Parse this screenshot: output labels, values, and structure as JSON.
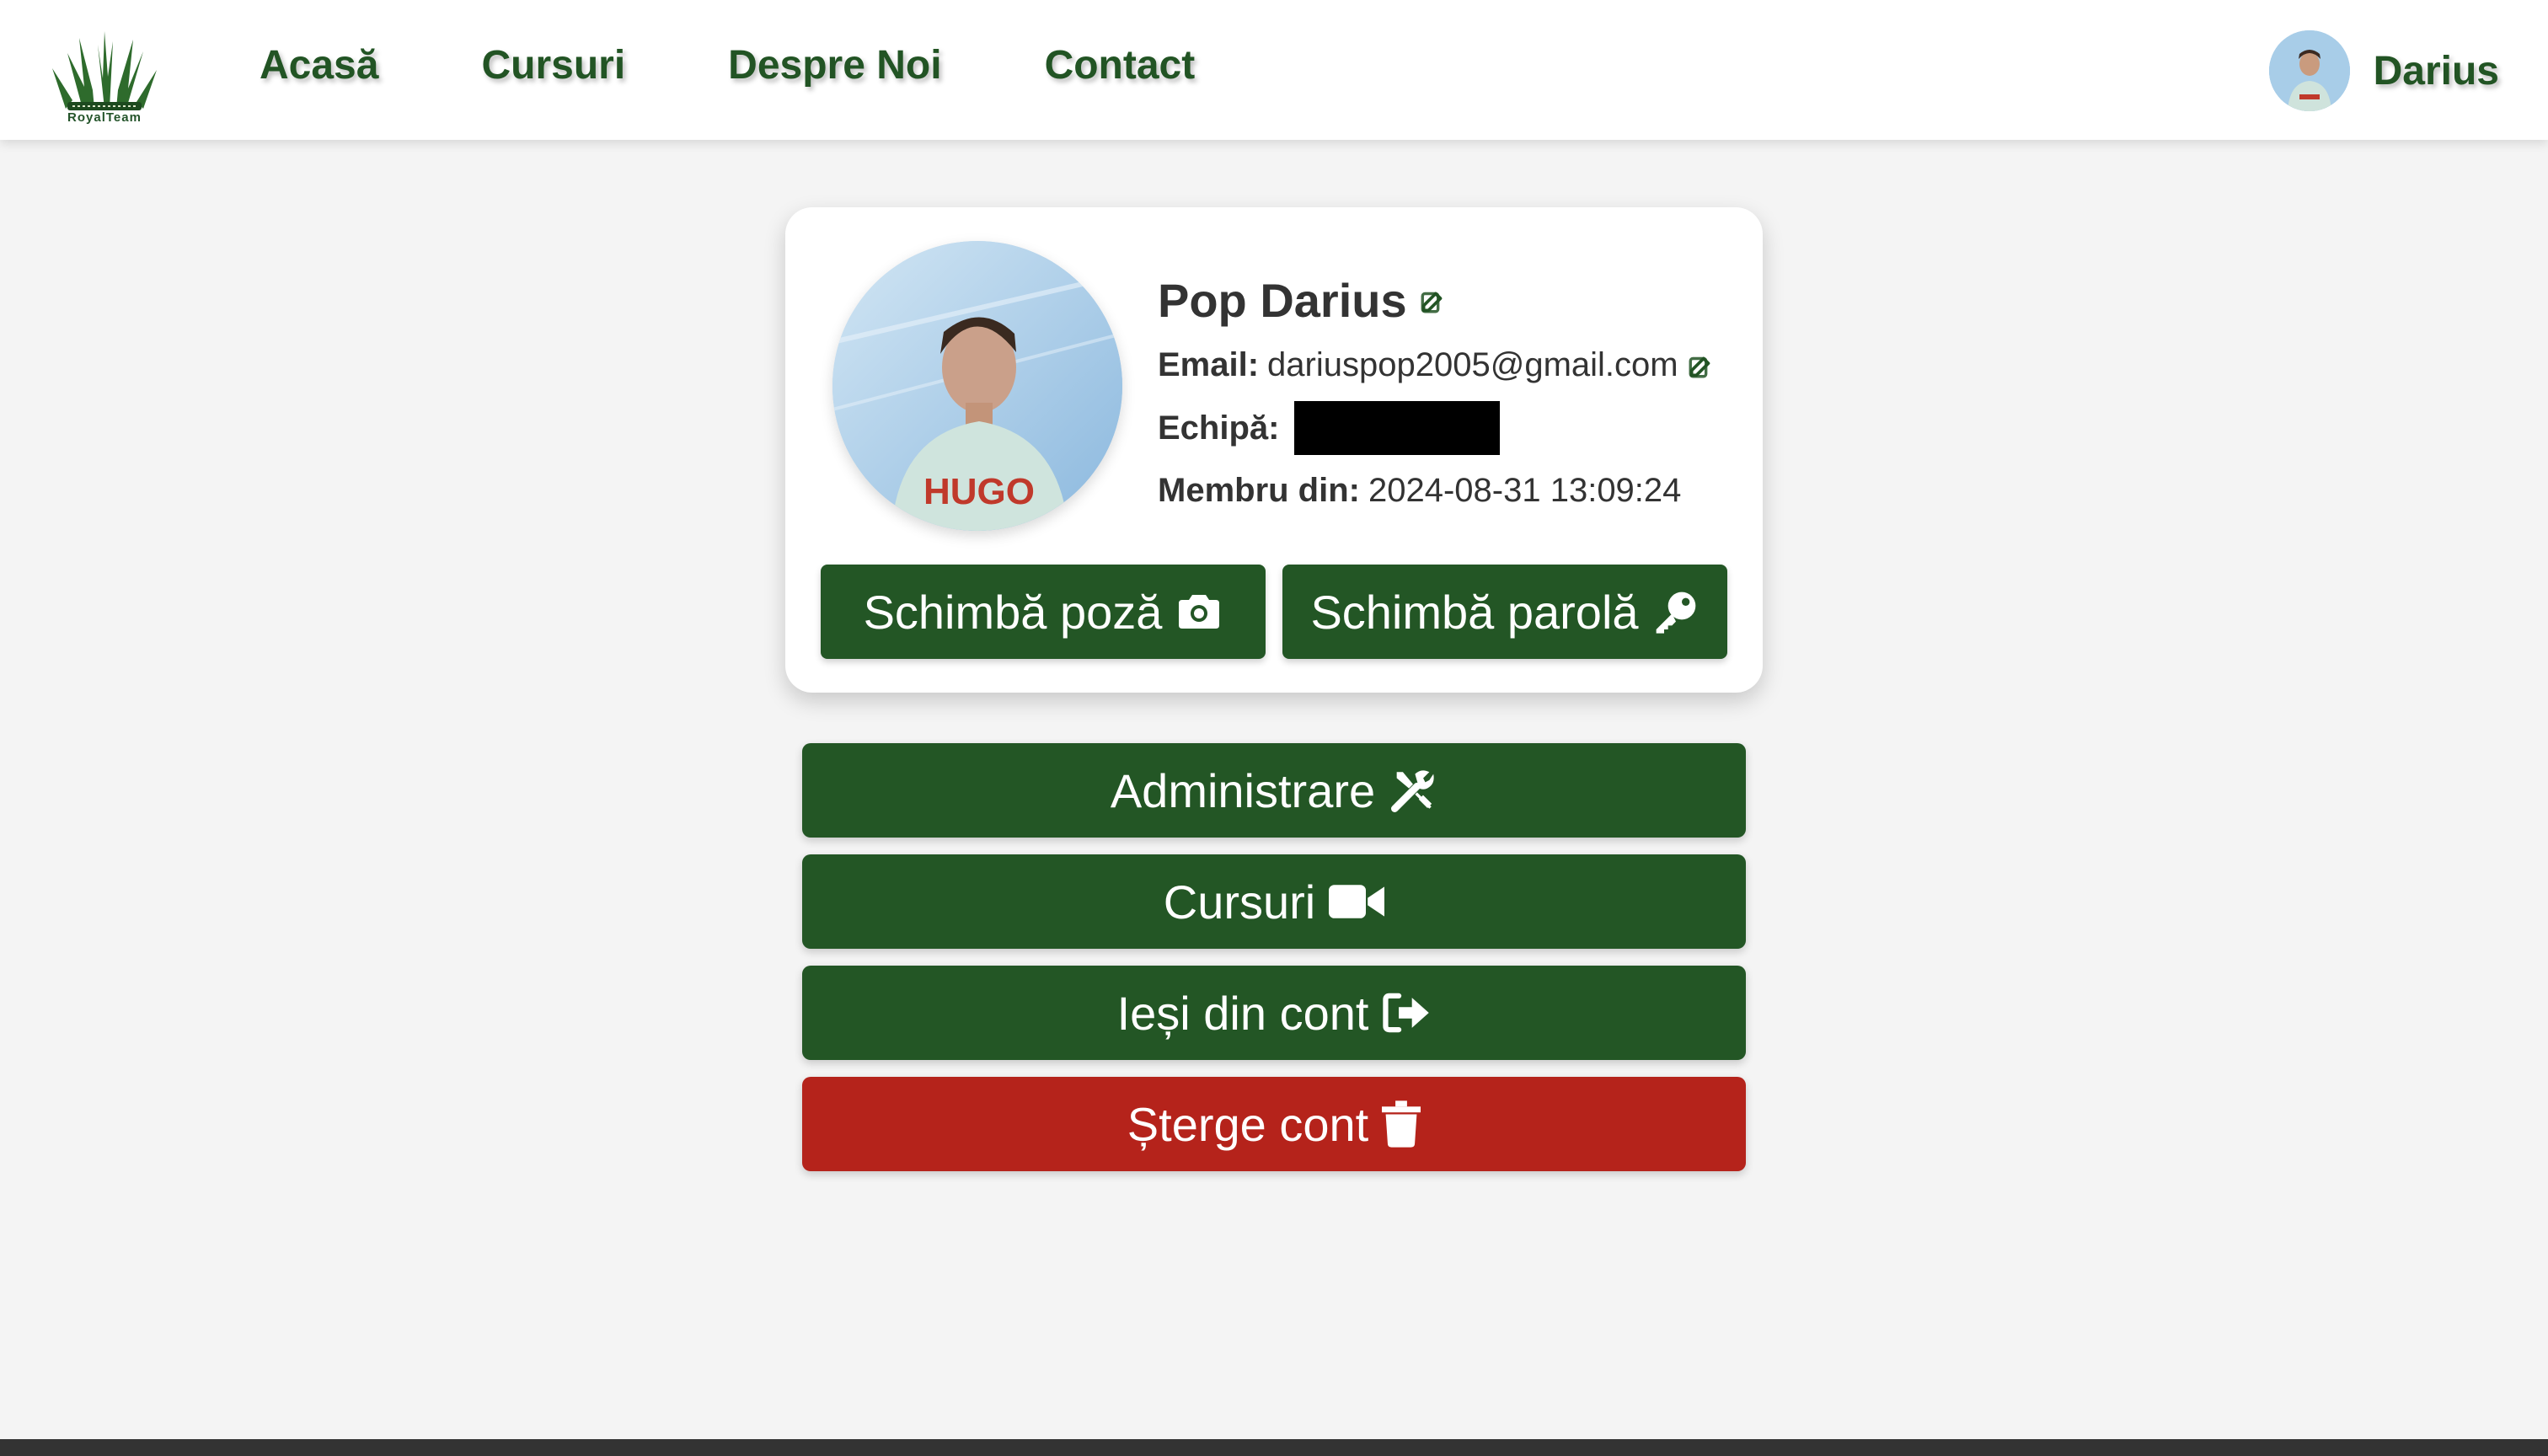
{
  "brand": {
    "logo_text": "RoyalTeam",
    "color": "#225424"
  },
  "nav": {
    "links": [
      "Acasă",
      "Cursuri",
      "Despre Noi",
      "Contact"
    ],
    "user_name": "Darius"
  },
  "profile": {
    "name": "Pop Darius",
    "email_label": "Email:",
    "email": "dariuspop2005@gmail.com",
    "team_label": "Echipă:",
    "team_value_redacted": true,
    "member_label": "Membru din:",
    "member_since": "2024-08-31 13:09:24",
    "shirt_text": "HUGO"
  },
  "card_buttons": {
    "change_photo": "Schimbă poză",
    "change_password": "Schimbă parolă"
  },
  "actions": {
    "admin": "Administrare",
    "courses": "Cursuri",
    "logout": "Ieși din cont",
    "delete": "Șterge cont"
  },
  "colors": {
    "primary": "#235625",
    "danger": "#b5231b",
    "background": "#f4f4f4"
  },
  "icons": {
    "edit": "edit-icon",
    "camera": "camera-icon",
    "key": "key-icon",
    "tools": "tools-icon",
    "video": "video-icon",
    "logout": "logout-icon",
    "trash": "trash-icon"
  }
}
